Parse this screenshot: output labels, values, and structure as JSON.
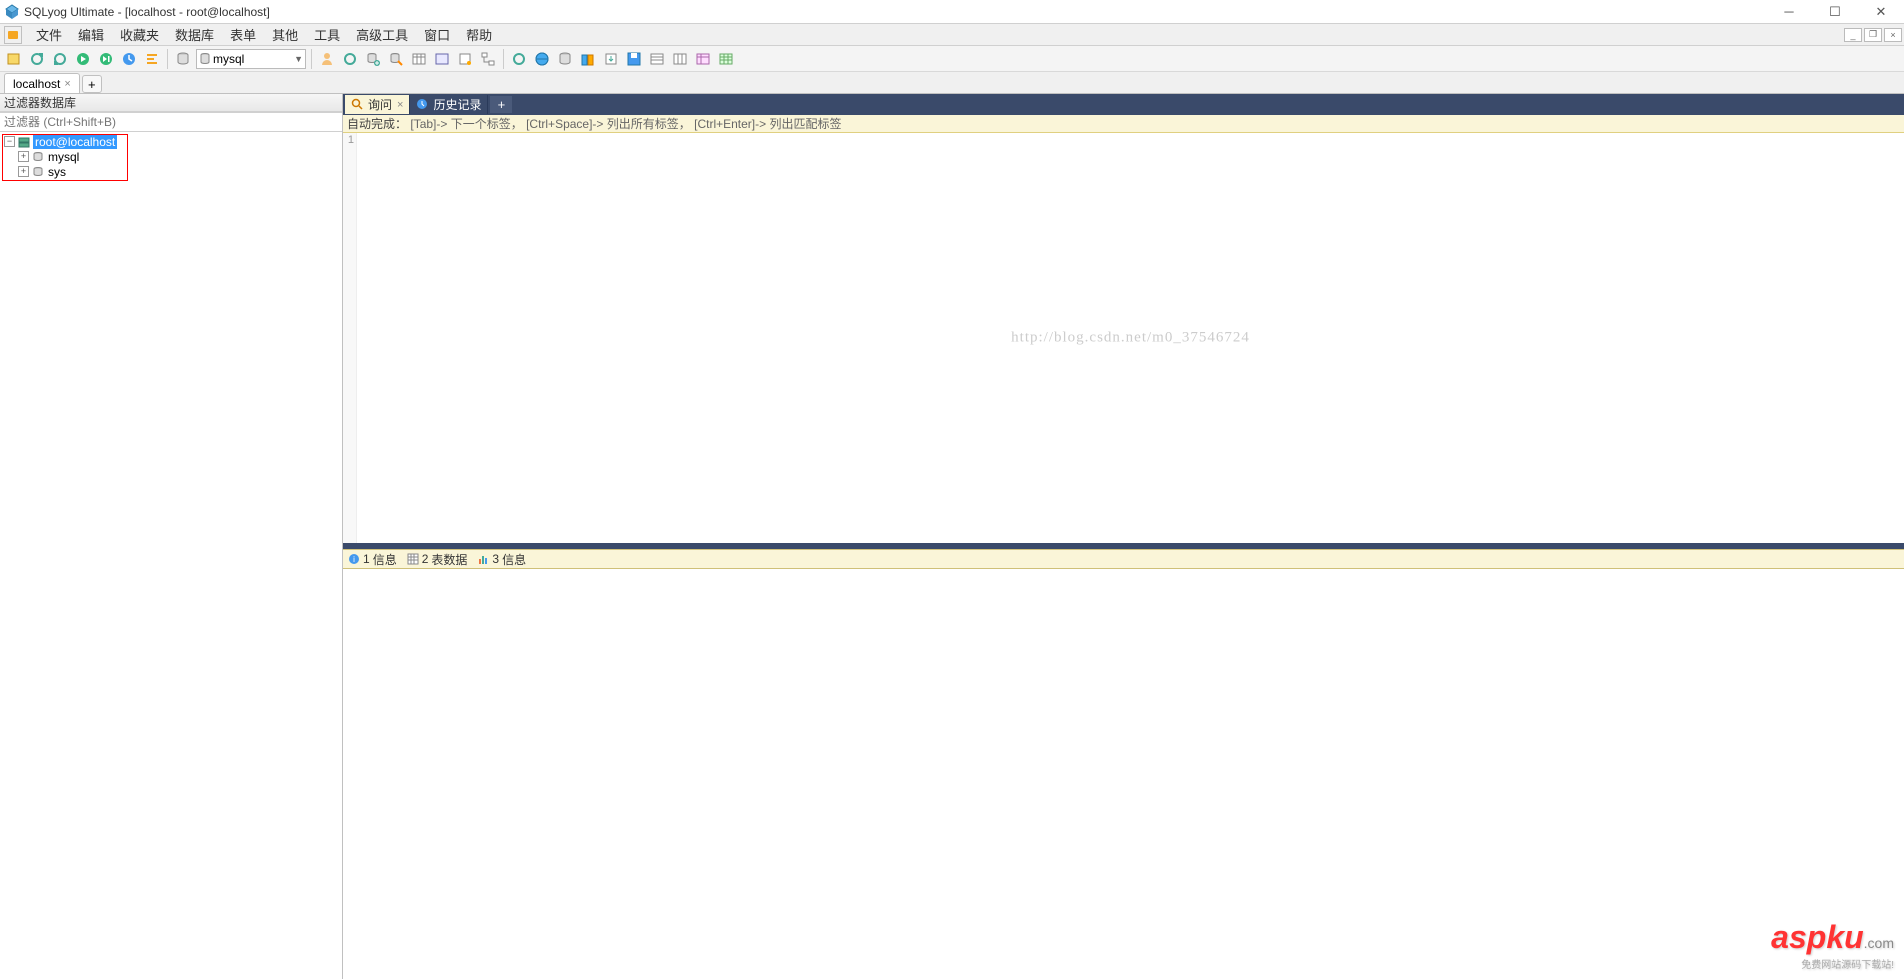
{
  "titlebar": {
    "text": "SQLyog Ultimate - [localhost - root@localhost]"
  },
  "menu": {
    "items": [
      "文件",
      "编辑",
      "收藏夹",
      "数据库",
      "表单",
      "其他",
      "工具",
      "高级工具",
      "窗口",
      "帮助"
    ]
  },
  "toolbar": {
    "db_selected": "mysql",
    "icons": [
      "new-conn-icon",
      "save-icon",
      "refresh-icon",
      "refresh-stop-icon",
      "play-icon",
      "play-next-icon",
      "stop-icon",
      "sep",
      "db-cylinder-icon",
      "sep",
      "db-select",
      "sep",
      "user-icon",
      "schema-refresh-icon",
      "db-add-icon",
      "db-remove-icon",
      "table-icon",
      "grid-icon",
      "copy-icon",
      "copy-db-icon",
      "sep",
      "tool1-icon",
      "tool-earth-icon",
      "tool-db-icon",
      "tool-columns-icon",
      "tool-export-icon",
      "tool-disk-icon",
      "tool-grid1-icon",
      "tool-grid2-icon",
      "tool-grid3-icon",
      "tool-grid4-icon"
    ]
  },
  "conn_tabs": {
    "tabs": [
      {
        "label": "localhost"
      }
    ],
    "add": "+"
  },
  "sidebar": {
    "header": "过滤器数据库",
    "filter_placeholder": "过滤器 (Ctrl+Shift+B)",
    "root": {
      "label": "root@localhost"
    },
    "children": [
      {
        "label": "mysql"
      },
      {
        "label": "sys"
      }
    ]
  },
  "query_tabs": {
    "tabs": [
      {
        "label": "询问",
        "active": true,
        "icon": "query-icon"
      },
      {
        "label": "历史记录",
        "active": false,
        "icon": "history-icon"
      }
    ],
    "add": "+"
  },
  "hint": {
    "prefix": "自动完成：",
    "parts": [
      "[Tab]-> 下一个标签，",
      "[Ctrl+Space]-> 列出所有标签，",
      "[Ctrl+Enter]-> 列出匹配标签"
    ]
  },
  "editor": {
    "line_number": "1",
    "watermark": "http://blog.csdn.net/m0_37546724"
  },
  "result_tabs": {
    "tabs": [
      {
        "index": "1",
        "label": "信息",
        "icon": "info-icon"
      },
      {
        "index": "2",
        "label": "表数据",
        "icon": "grid-icon"
      },
      {
        "index": "3",
        "label": "信息",
        "icon": "status-icon"
      }
    ]
  },
  "watermark_logo": {
    "main": "aspku",
    "dom": ".com",
    "sub": "免费网站源码下载站!"
  }
}
